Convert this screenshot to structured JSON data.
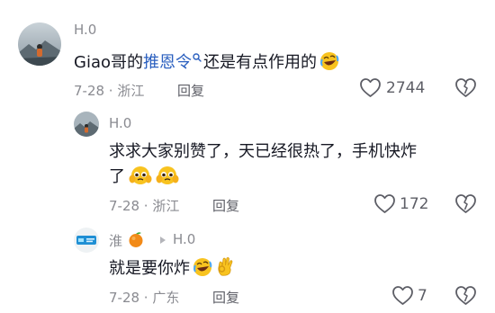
{
  "comments": [
    {
      "username": "H.0",
      "text_before": "Giao哥的",
      "link_text": "推恩令",
      "text_after": "还是有点作用的",
      "emoji": "rolling-laugh",
      "date_location": "7-28 · 浙江",
      "reply_label": "回复",
      "like_count": "2744"
    },
    {
      "username": "H.0",
      "text_line1": "求求大家别赞了，天已经很热了，手机快炸",
      "text_line2": "了",
      "emoji": "pleading-face",
      "date_location": "7-28 · 浙江",
      "reply_label": "回复",
      "like_count": "172"
    },
    {
      "username": "淮",
      "reply_to": "H.0",
      "text": "就是要你炸",
      "emoji": [
        "rolling-laugh",
        "ok-hand"
      ],
      "date_location": "7-28 · 广东",
      "reply_label": "回复",
      "like_count": "7"
    }
  ]
}
